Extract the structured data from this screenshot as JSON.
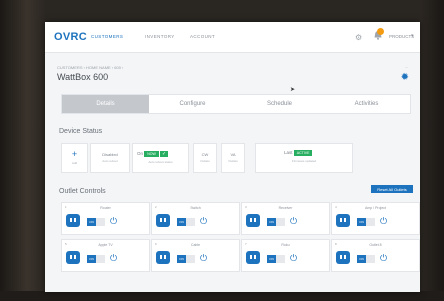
{
  "app": {
    "logo": "OVRC"
  },
  "nav": [
    {
      "label": "CUSTOMERS"
    },
    {
      "label": "INVENTORY"
    },
    {
      "label": "ACCOUNT"
    }
  ],
  "user": {
    "label": "PRODUCTS"
  },
  "device": {
    "breadcrumb": "CUSTOMERS › HOME NAME › 600 ›",
    "title": "WattBox 600",
    "top_right": "..."
  },
  "tabs": [
    "Details",
    "Configure",
    "Schedule",
    "Activities"
  ],
  "status": {
    "heading": "Device Status",
    "add_label": "Add",
    "disabled_label": "Disabled",
    "disabled_sub": "Auto reboot",
    "on_label": "On",
    "on_pill": "NOW",
    "on_sub": "Auto reboot status",
    "cw_label": "CW",
    "cw_sub": "Outlets",
    "va_label": "VA",
    "va_sub": "Outlets",
    "last_label": "Last",
    "last_pill": "ACTIVE",
    "last_sub": "Firmware updated"
  },
  "outlets": {
    "heading": "Outlet Controls",
    "reset_label": "Reset All Outlets",
    "on_text": "ON",
    "items": [
      {
        "num": "1",
        "name": "Router"
      },
      {
        "num": "2",
        "name": "Switch"
      },
      {
        "num": "3",
        "name": "Receiver"
      },
      {
        "num": "4",
        "name": "Amp / Project"
      },
      {
        "num": "5",
        "name": "Apple TV"
      },
      {
        "num": "6",
        "name": "Cable"
      },
      {
        "num": "7",
        "name": "Roku"
      },
      {
        "num": "8",
        "name": "Outlet 8"
      }
    ]
  },
  "colors": {
    "accent": "#1e73be",
    "on": "#27ae60",
    "badge": "#f39c12"
  }
}
